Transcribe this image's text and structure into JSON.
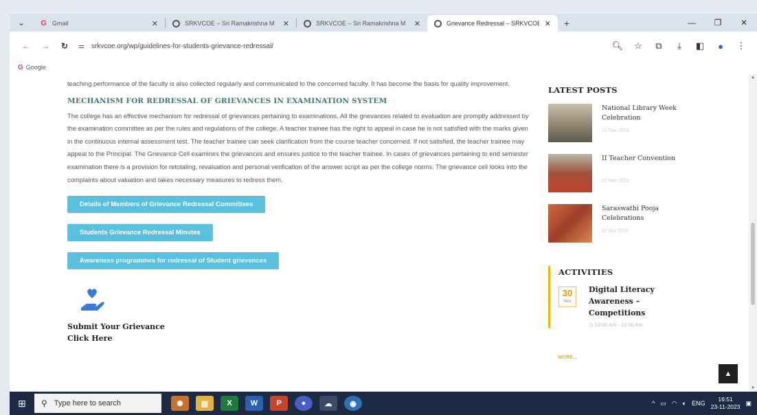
{
  "browser": {
    "tabs": [
      {
        "title": "Gmail",
        "active": false
      },
      {
        "title": "SRKVCOE – Sri Ramakrishna M",
        "active": false
      },
      {
        "title": "SRKVCOE – Sri Ramakrishna M",
        "active": false
      },
      {
        "title": "Grievance Redressal – SRKVCOE",
        "active": true
      }
    ],
    "url": "srkvcoe.org/wp/guidelines-for-students-grievance-redressal/",
    "bookmarks": [
      "Google"
    ]
  },
  "content": {
    "intro_text": "teaching performance of the faculty is also collected regularly and communicated to the concerned faculty. It has become the basis for quality improvement.",
    "heading": "MECHANISM FOR REDRESSAL OF GRIEVANCES IN EXAMINATION SYSTEM",
    "body_text": "The college has an effective mechanism for redressal of grievances pertaining to examinations. All the grievances related to evaluation are promptly addressed by the examination committee as per the rules and regulations of the college. A teacher trainee has the right to appeal in case he is not satisfied with the marks given in the continuous internal assessment test. The teacher trainee can seek clarification from the course teacher concerned. If not satisfied, the teacher trainee may appeal to the Principal. The Grievance Cell examines the grievances and ensures justice to the teacher trainee. In cases of grievances pertaining to end semester examination there is a provision for retotaling, revaluation and personal verification of the answer script as per the college norms. The grievance cell looks into the complaints about valuation and takes necessary measures to redress them.",
    "buttons": [
      "Details of Members of Grievance Redressal Committees",
      "Students Grievance Redressal Minutes",
      "Awareness programmes for redressal of Student grievences"
    ],
    "submit_line1": "Submit Your Grievance",
    "submit_line2": "Click Here"
  },
  "sidebar": {
    "latest_posts_title": "LATEST POSTS",
    "posts": [
      {
        "title_line1": "National Library Week",
        "title_line2": "Celebration",
        "date": "13 Nov 2023"
      },
      {
        "title_line1": "II Teacher Convention",
        "title_line2": "",
        "date": "07 Nov 2023"
      },
      {
        "title_line1": "Saraswathi Pooja",
        "title_line2": "Celebrations",
        "date": "23 Oct 2023"
      }
    ],
    "activities_title": "ACTIVITIES",
    "event": {
      "day": "30",
      "month": "Nov",
      "title_line1": "Digital Literacy",
      "title_line2": "Awareness –",
      "title_line3": "Competitions",
      "time": "12:00 Am - 12:00 Am"
    },
    "more_label": "MORE..."
  },
  "taskbar": {
    "search_placeholder": "Type here to search",
    "language": "ENG",
    "time": "16:51",
    "date": "23-11-2023"
  },
  "colors": {
    "button": "#5bc0de",
    "heading": "#3a7a7a",
    "accent": "#f0b400"
  }
}
